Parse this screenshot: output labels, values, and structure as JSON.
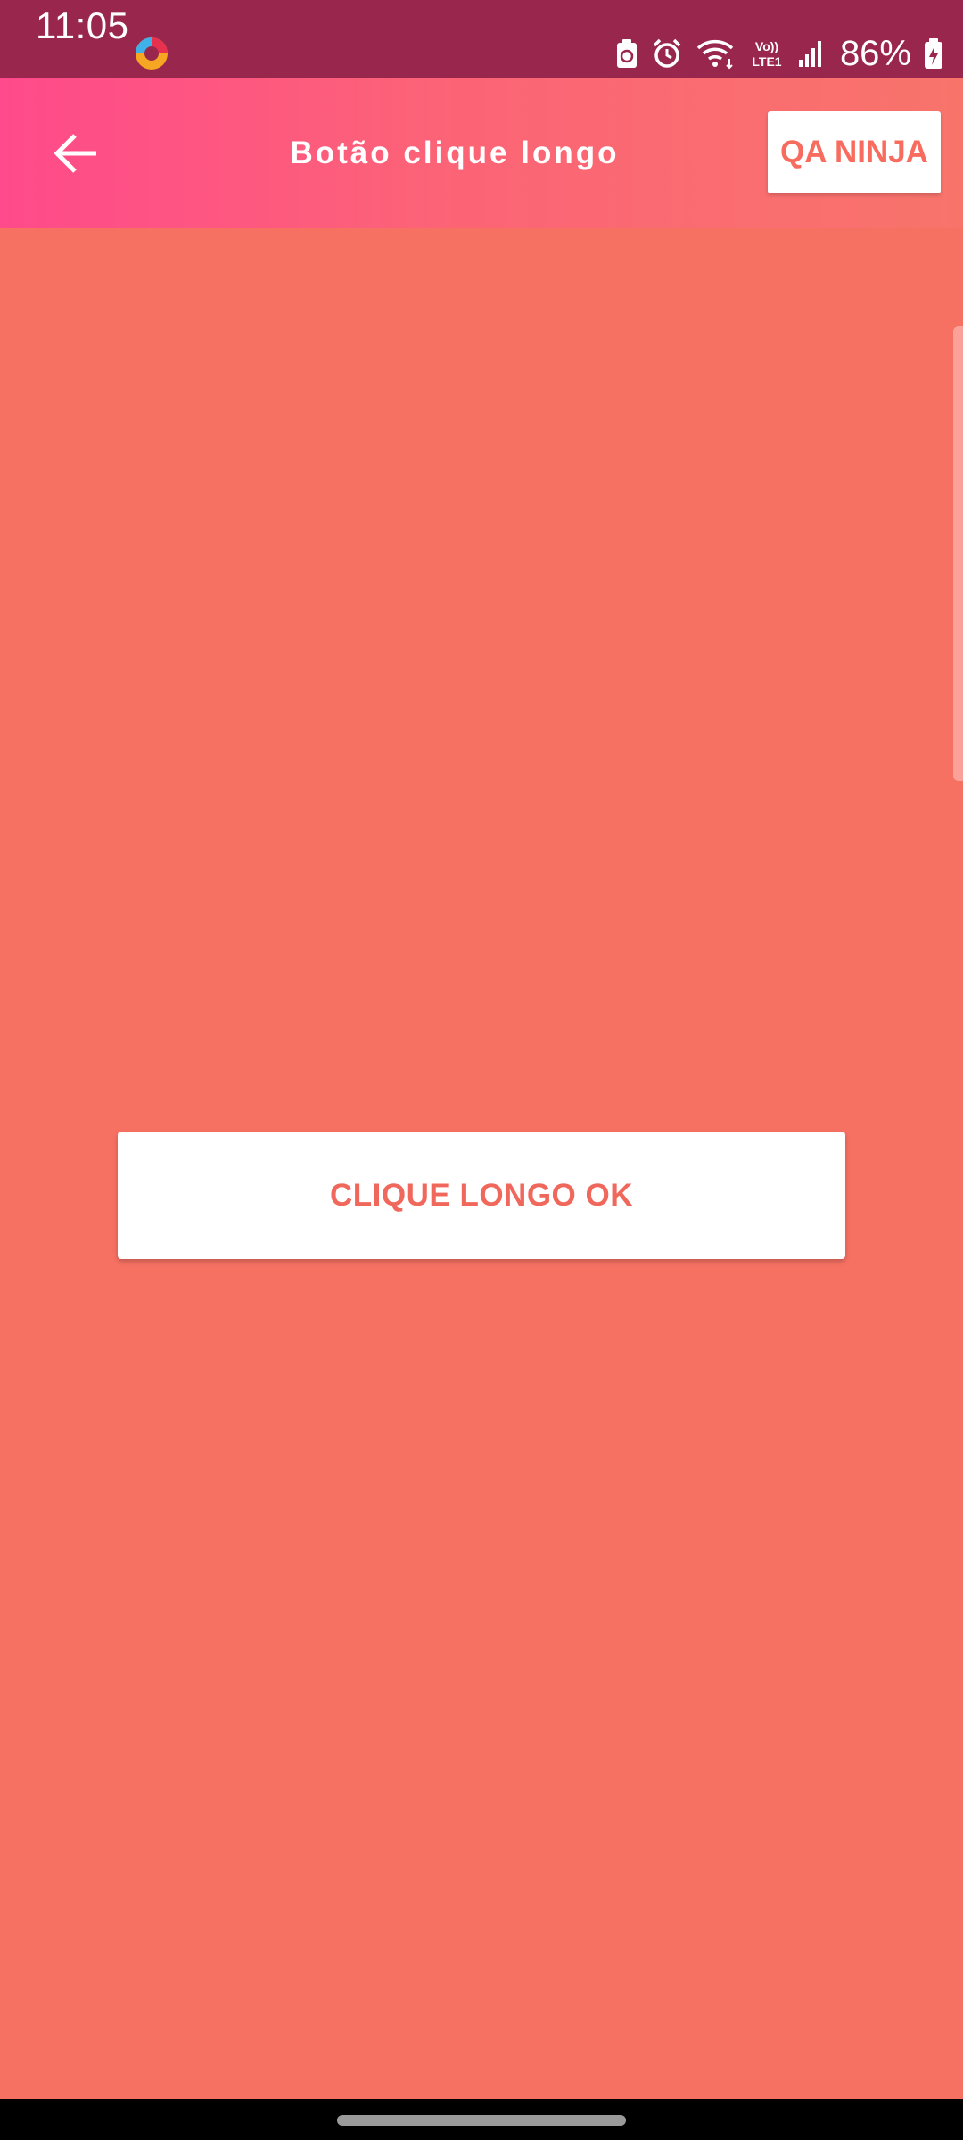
{
  "status_bar": {
    "time": "11:05",
    "battery_percent": "86%",
    "network_label": "Vo)) LTE1",
    "icons": [
      "app-notification-icon",
      "battery-saver-icon",
      "alarm-icon",
      "wifi-icon",
      "volte-lte-icon",
      "signal-icon",
      "battery-charging-icon"
    ]
  },
  "app_bar": {
    "title": "Botão clique longo",
    "back_icon": "arrow-left-icon",
    "brand_button_label": "QA NINJA"
  },
  "main": {
    "long_click_button_label": "CLIQUE LONGO OK"
  },
  "colors": {
    "status_bar": "#99264d",
    "app_bar_gradient_start": "#ff4a8b",
    "app_bar_gradient_end": "#f8746b",
    "background": "#f77163",
    "accent_text": "#f0685b",
    "button_bg": "#ffffff"
  }
}
